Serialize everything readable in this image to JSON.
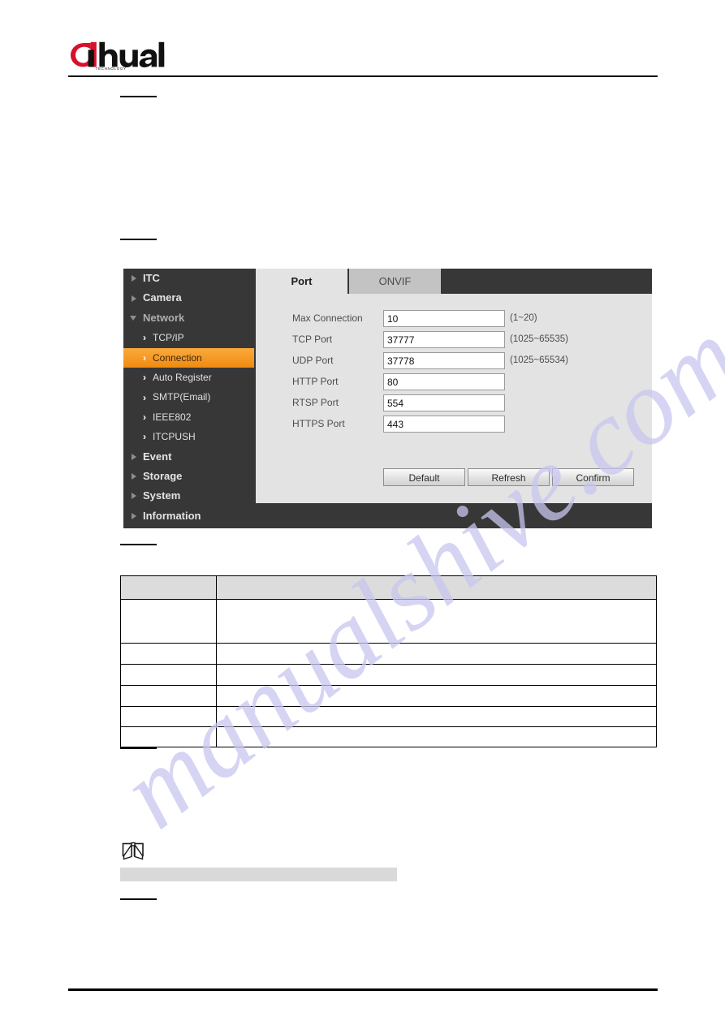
{
  "document": {
    "brand": {
      "name": "alhua",
      "wordmark": "dahua",
      "tagline": "TECHNOLOGY"
    },
    "watermark": "manualshive.com"
  },
  "device_ui": {
    "sidebar": {
      "items": [
        {
          "label": "ITC",
          "level": "top",
          "icon": "triangle-right-icon",
          "state": "collapsed"
        },
        {
          "label": "Camera",
          "level": "top",
          "icon": "triangle-right-icon",
          "state": "collapsed"
        },
        {
          "label": "Network",
          "level": "top",
          "icon": "triangle-down-icon",
          "state": "expanded"
        },
        {
          "label": "TCP/IP",
          "level": "sub",
          "icon": "chevron-right-icon",
          "state": "normal"
        },
        {
          "label": "Connection",
          "level": "sub",
          "icon": "chevron-right-icon",
          "state": "active"
        },
        {
          "label": "Auto Register",
          "level": "sub",
          "icon": "chevron-right-icon",
          "state": "normal"
        },
        {
          "label": "SMTP(Email)",
          "level": "sub",
          "icon": "chevron-right-icon",
          "state": "normal"
        },
        {
          "label": "IEEE802",
          "level": "sub",
          "icon": "chevron-right-icon",
          "state": "normal"
        },
        {
          "label": "ITCPUSH",
          "level": "sub",
          "icon": "chevron-right-icon",
          "state": "normal"
        },
        {
          "label": "Event",
          "level": "top",
          "icon": "triangle-right-icon",
          "state": "collapsed"
        },
        {
          "label": "Storage",
          "level": "top",
          "icon": "triangle-right-icon",
          "state": "collapsed"
        },
        {
          "label": "System",
          "level": "top",
          "icon": "triangle-right-icon",
          "state": "collapsed"
        },
        {
          "label": "Information",
          "level": "top",
          "icon": "triangle-right-icon",
          "state": "collapsed"
        }
      ],
      "accent_color": "#f3930f",
      "background_color": "#373737"
    },
    "tabs": [
      {
        "label": "Port",
        "active": true
      },
      {
        "label": "ONVIF",
        "active": false
      }
    ],
    "form": {
      "fields": [
        {
          "label": "Max Connection",
          "value": "10",
          "hint": "(1~20)"
        },
        {
          "label": "TCP Port",
          "value": "37777",
          "hint": "(1025~65535)"
        },
        {
          "label": "UDP Port",
          "value": "37778",
          "hint": "(1025~65534)"
        },
        {
          "label": "HTTP Port",
          "value": "80",
          "hint": ""
        },
        {
          "label": "RTSP Port",
          "value": "554",
          "hint": ""
        },
        {
          "label": "HTTPS Port",
          "value": "443",
          "hint": ""
        }
      ],
      "buttons": [
        {
          "label": "Default"
        },
        {
          "label": "Refresh"
        },
        {
          "label": "Confirm"
        }
      ]
    }
  },
  "table": {
    "headers": [
      "",
      ""
    ],
    "rows": [
      [
        "",
        ""
      ],
      [
        "",
        ""
      ],
      [
        "",
        ""
      ],
      [
        "",
        ""
      ],
      [
        "",
        ""
      ],
      [
        "",
        ""
      ]
    ]
  },
  "note": {
    "icon": "open-book-icon",
    "text": ""
  }
}
